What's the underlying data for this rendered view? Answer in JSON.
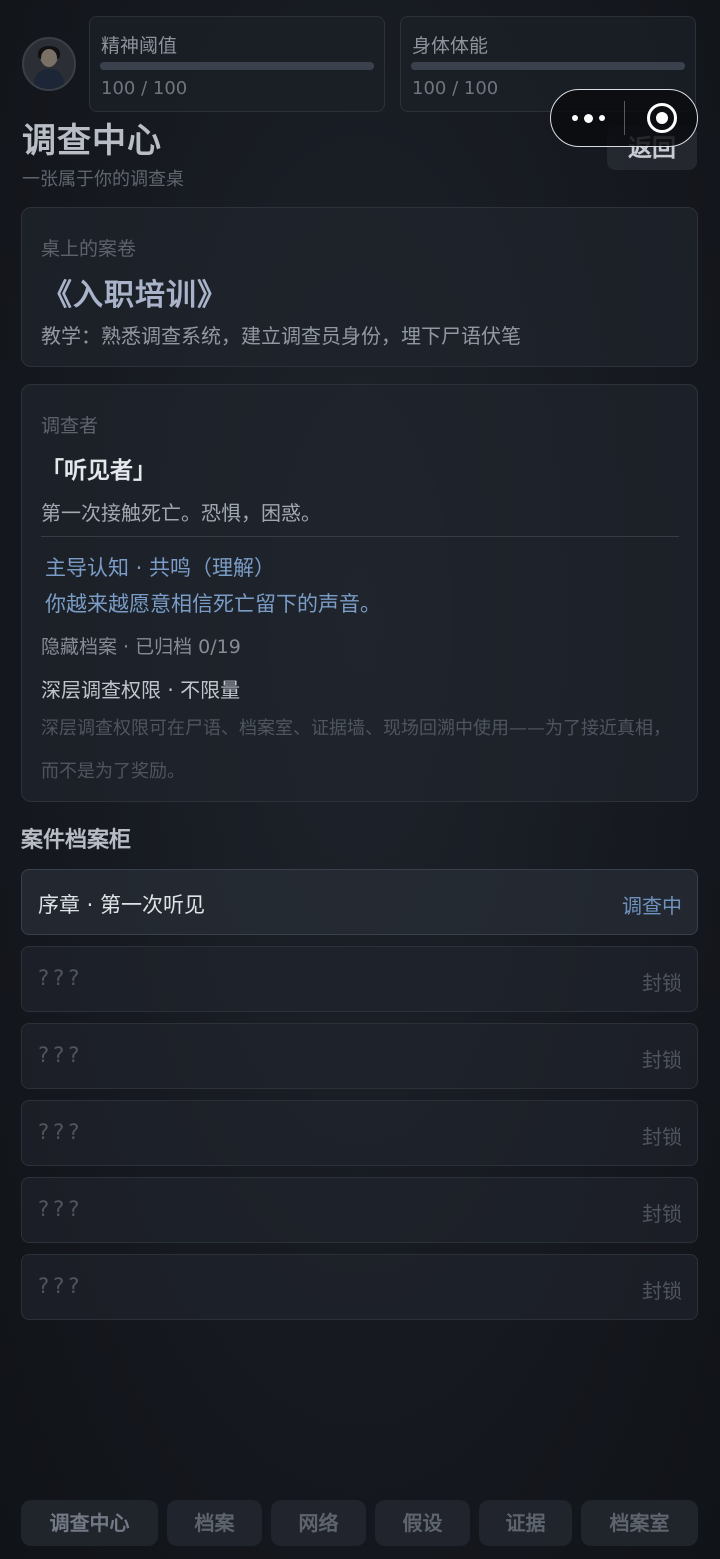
{
  "status": {
    "mental": {
      "label": "精神阈值",
      "value_text": "100 / 100",
      "fraction": 1.0
    },
    "physical": {
      "label": "身体体能",
      "value_text": "100 / 100",
      "fraction": 1.0
    }
  },
  "header": {
    "title": "调查中心",
    "subtitle": "一张属于你的调查桌",
    "back_label": "返回"
  },
  "current_case": {
    "section_label": "桌上的案卷",
    "title": "《入职培训》",
    "description": "教学：熟悉调查系统，建立调查员身份，埋下尸语伏笔"
  },
  "investigator": {
    "section_label": "调查者",
    "name": "「听见者」",
    "description": "第一次接触死亡。恐惧，困惑。",
    "cognition_line1": "主导认知 · 共鸣（理解）",
    "cognition_line2": "你越来越愿意相信死亡留下的声音。",
    "archive_status": "隐藏档案 · 已归档 0/19",
    "deep_access": "深层调查权限 · 不限量",
    "deep_access_note": "深层调查权限可在尸语、档案室、证据墙、现场回溯中使用——为了接近真相，而不是为了奖励。"
  },
  "cabinet": {
    "title": "案件档案柜",
    "cases": [
      {
        "name": "序章 · 第一次听见",
        "status": "调查中",
        "active": true
      },
      {
        "name": "???",
        "status": "封锁",
        "active": false
      },
      {
        "name": "???",
        "status": "封锁",
        "active": false
      },
      {
        "name": "???",
        "status": "封锁",
        "active": false
      },
      {
        "name": "???",
        "status": "封锁",
        "active": false
      },
      {
        "name": "???",
        "status": "封锁",
        "active": false
      }
    ]
  },
  "nav": {
    "tabs": [
      {
        "label": "调查中心",
        "active": true
      },
      {
        "label": "档案",
        "active": false
      },
      {
        "label": "网络",
        "active": false
      },
      {
        "label": "假设",
        "active": false
      },
      {
        "label": "证据",
        "active": false
      },
      {
        "label": "档案室",
        "active": false
      }
    ]
  },
  "colors": {
    "accent_blue": "#7a9cc6",
    "status_active": "#6f93bf",
    "background": "#171b22"
  },
  "icons": {
    "menu": "more-dots-icon",
    "close": "target-circle-icon"
  }
}
